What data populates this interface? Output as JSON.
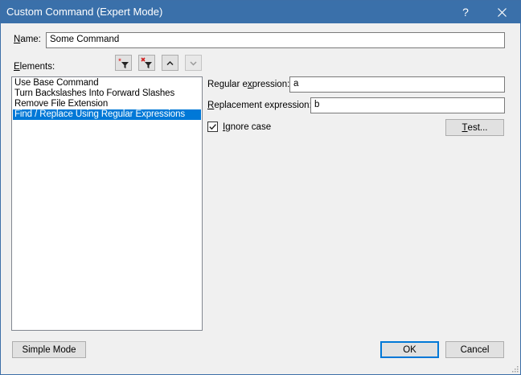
{
  "window": {
    "title": "Custom Command (Expert Mode)",
    "help_glyph": "?",
    "close_glyph": "✕"
  },
  "name_field": {
    "label_mnemonic": "N",
    "label_rest": "ame:",
    "value": "Some Command"
  },
  "elements": {
    "label_mnemonic": "E",
    "label_rest": "lements:",
    "items": [
      {
        "label": "Use Base Command",
        "selected": false
      },
      {
        "label": "Turn Backslashes Into Forward Slashes",
        "selected": false
      },
      {
        "label": "Remove File Extension",
        "selected": false
      },
      {
        "label": "Find / Replace Using Regular Expressions",
        "selected": true
      }
    ]
  },
  "toolbar": {
    "add_icon": "add-filter-icon",
    "remove_icon": "remove-filter-icon",
    "up_icon": "chevron-up-icon",
    "down_icon": "chevron-down-icon"
  },
  "regex": {
    "label_pre": "Regular e",
    "label_mnemonic": "x",
    "label_post": "pression:",
    "value": "a"
  },
  "replacement": {
    "label_mnemonic": "R",
    "label_rest": "eplacement expression:",
    "value": "b"
  },
  "ignore_case": {
    "label_mnemonic": "I",
    "label_rest": "gnore case",
    "checked": true
  },
  "test_button": {
    "label_mnemonic": "T",
    "label_rest": "est..."
  },
  "footer": {
    "simple_mode": "Simple Mode",
    "ok": "OK",
    "cancel": "Cancel"
  },
  "colors": {
    "titlebar": "#3a70aa",
    "selection": "#0078d7",
    "default_button_border": "#0078d7"
  }
}
